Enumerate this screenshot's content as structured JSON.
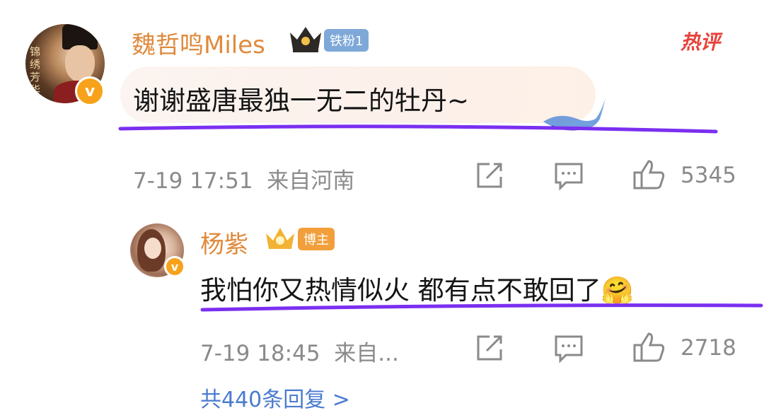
{
  "comment": {
    "username": "魏哲鸣Miles",
    "fan_badge": "铁粉1",
    "hot_label": "热评",
    "avatar_text": "锦绣芳华",
    "text": "谢谢盛唐最独一无二的牡丹~",
    "time": "7-19 17:51",
    "location": "来自河南",
    "likes": "5345",
    "verified_badge": "v"
  },
  "reply": {
    "username": "杨紫",
    "role_badge": "博主",
    "text": "我怕你又热情似火 都有点不敢回了🤗",
    "time": "7-19 18:45",
    "location": "来自...",
    "likes": "2718",
    "verified_badge": "v"
  },
  "more_replies": "共440条回复 >",
  "colors": {
    "username": "#e08a3c",
    "fan_badge_bg": "#7ea8d8",
    "role_badge_bg": "#f29f3b",
    "hot_label": "#e8423a",
    "verified": "#f7a21a",
    "underline": "#7b2ff0",
    "meta": "#8a8a8a"
  },
  "icons": [
    "crown-icon",
    "share-icon",
    "comment-icon",
    "like-icon",
    "whale-icon",
    "hug-emoji-icon"
  ]
}
